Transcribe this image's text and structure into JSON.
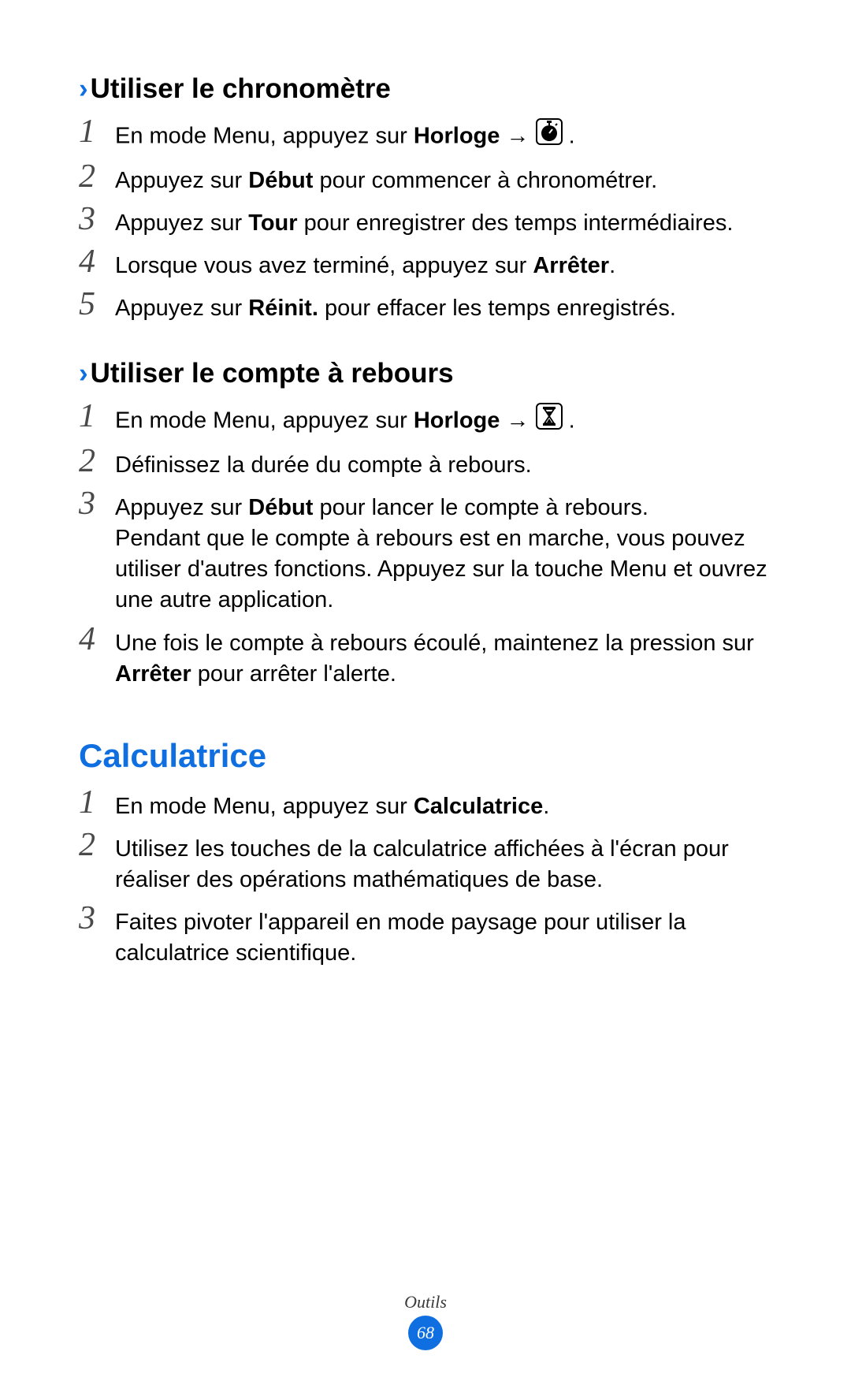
{
  "section1": {
    "heading": "Utiliser le chronomètre",
    "steps": [
      {
        "before": "En mode Menu, appuyez sur ",
        "bold": "Horloge",
        "afterbold": " ",
        "icon": "stopwatch-icon",
        "after": " ."
      },
      {
        "before": "Appuyez sur ",
        "bold": "Début",
        "after": " pour commencer à chronométrer."
      },
      {
        "before": "Appuyez sur ",
        "bold": "Tour",
        "after": " pour enregistrer des temps intermédiaires."
      },
      {
        "before": "Lorsque vous avez terminé, appuyez sur ",
        "bold": "Arrêter",
        "after": "."
      },
      {
        "before": "Appuyez sur ",
        "bold": "Réinit.",
        "after": " pour effacer les temps enregistrés."
      }
    ]
  },
  "section2": {
    "heading": "Utiliser le compte à rebours",
    "steps": [
      {
        "before": "En mode Menu, appuyez sur ",
        "bold": "Horloge",
        "afterbold": " ",
        "icon": "hourglass-icon",
        "after": " ."
      },
      {
        "text": "Définissez la durée du compte à rebours."
      },
      {
        "before": "Appuyez sur ",
        "bold": "Début",
        "after": " pour lancer le compte à rebours.",
        "extra": "Pendant que le compte à rebours est en marche, vous pouvez utiliser d'autres fonctions. Appuyez sur la touche Menu et ouvrez une autre application."
      },
      {
        "before": "Une fois le compte à rebours écoulé, maintenez la pression sur ",
        "bold": "Arrêter",
        "after": " pour arrêter l'alerte."
      }
    ]
  },
  "calc": {
    "title": "Calculatrice",
    "steps": [
      {
        "before": "En mode Menu, appuyez sur ",
        "bold": "Calculatrice",
        "after": "."
      },
      {
        "text": "Utilisez les touches de la calculatrice affichées à l'écran pour réaliser des opérations mathématiques de base."
      },
      {
        "text": "Faites pivoter l'appareil en mode paysage pour utiliser la calculatrice scientifique."
      }
    ]
  },
  "footer": {
    "category": "Outils",
    "page": "68"
  },
  "arrows": "→"
}
